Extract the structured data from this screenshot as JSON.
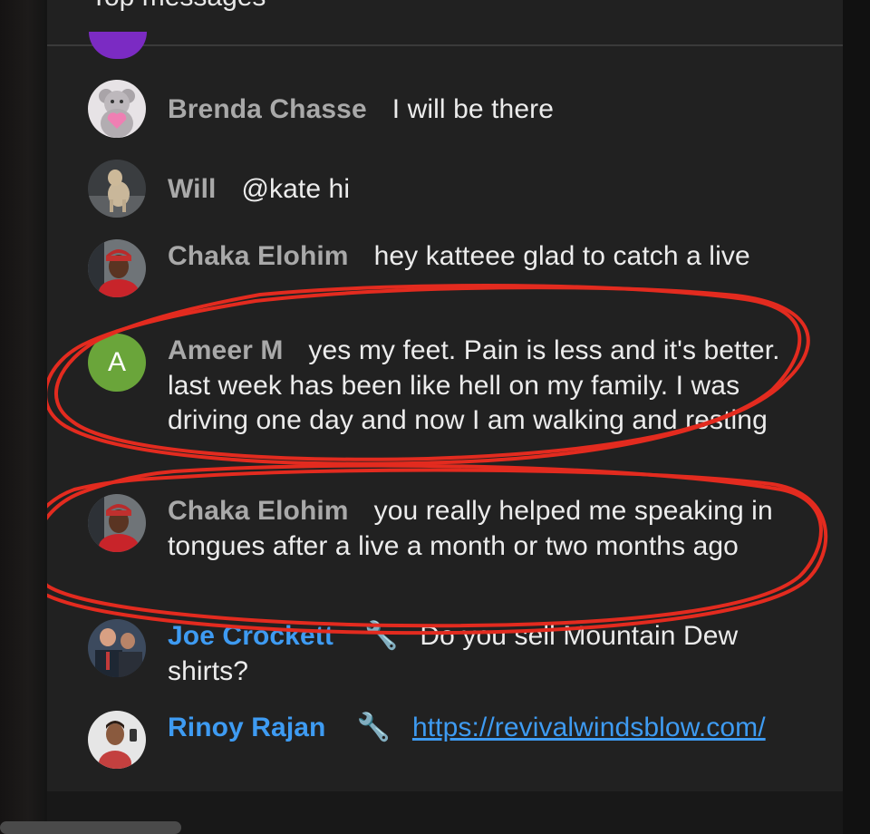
{
  "header": {
    "title": "Top messages"
  },
  "messages": [
    {
      "avatar": "teddy-bear-avatar",
      "author": "Brenda Chasse",
      "text": "I will be there"
    },
    {
      "avatar": "dog-avatar",
      "author": "Will",
      "text": "@kate hi"
    },
    {
      "avatar": "woman-car-avatar",
      "author": "Chaka Elohim",
      "text": "hey katteee glad to catch a live"
    },
    {
      "avatar": "letter-avatar",
      "avatar_letter": "A",
      "avatar_color": "#6aa53a",
      "author": "Ameer M",
      "text": "yes my feet. Pain is less and it's better. last week has been like hell on my family. I was driving one day and now I am walking and resting"
    },
    {
      "avatar": "woman-car-avatar",
      "author": "Chaka Elohim",
      "text": "you really helped me speaking in tongues after a live a month or two months ago"
    },
    {
      "avatar": "group-photo-avatar",
      "author": "Joe Crockett",
      "badge": "wrench-icon",
      "text": "Do you sell Mountain Dew shirts?"
    },
    {
      "avatar": "man-selfie-avatar",
      "author": "Rinoy Rajan",
      "badge": "wrench-icon",
      "link": "https://revivalwindsblow.com/"
    }
  ],
  "colors": {
    "background": "#212121",
    "owner_name": "#3e9bf2",
    "author_name": "#a9a9a9",
    "annotation": "#e32b1f"
  }
}
